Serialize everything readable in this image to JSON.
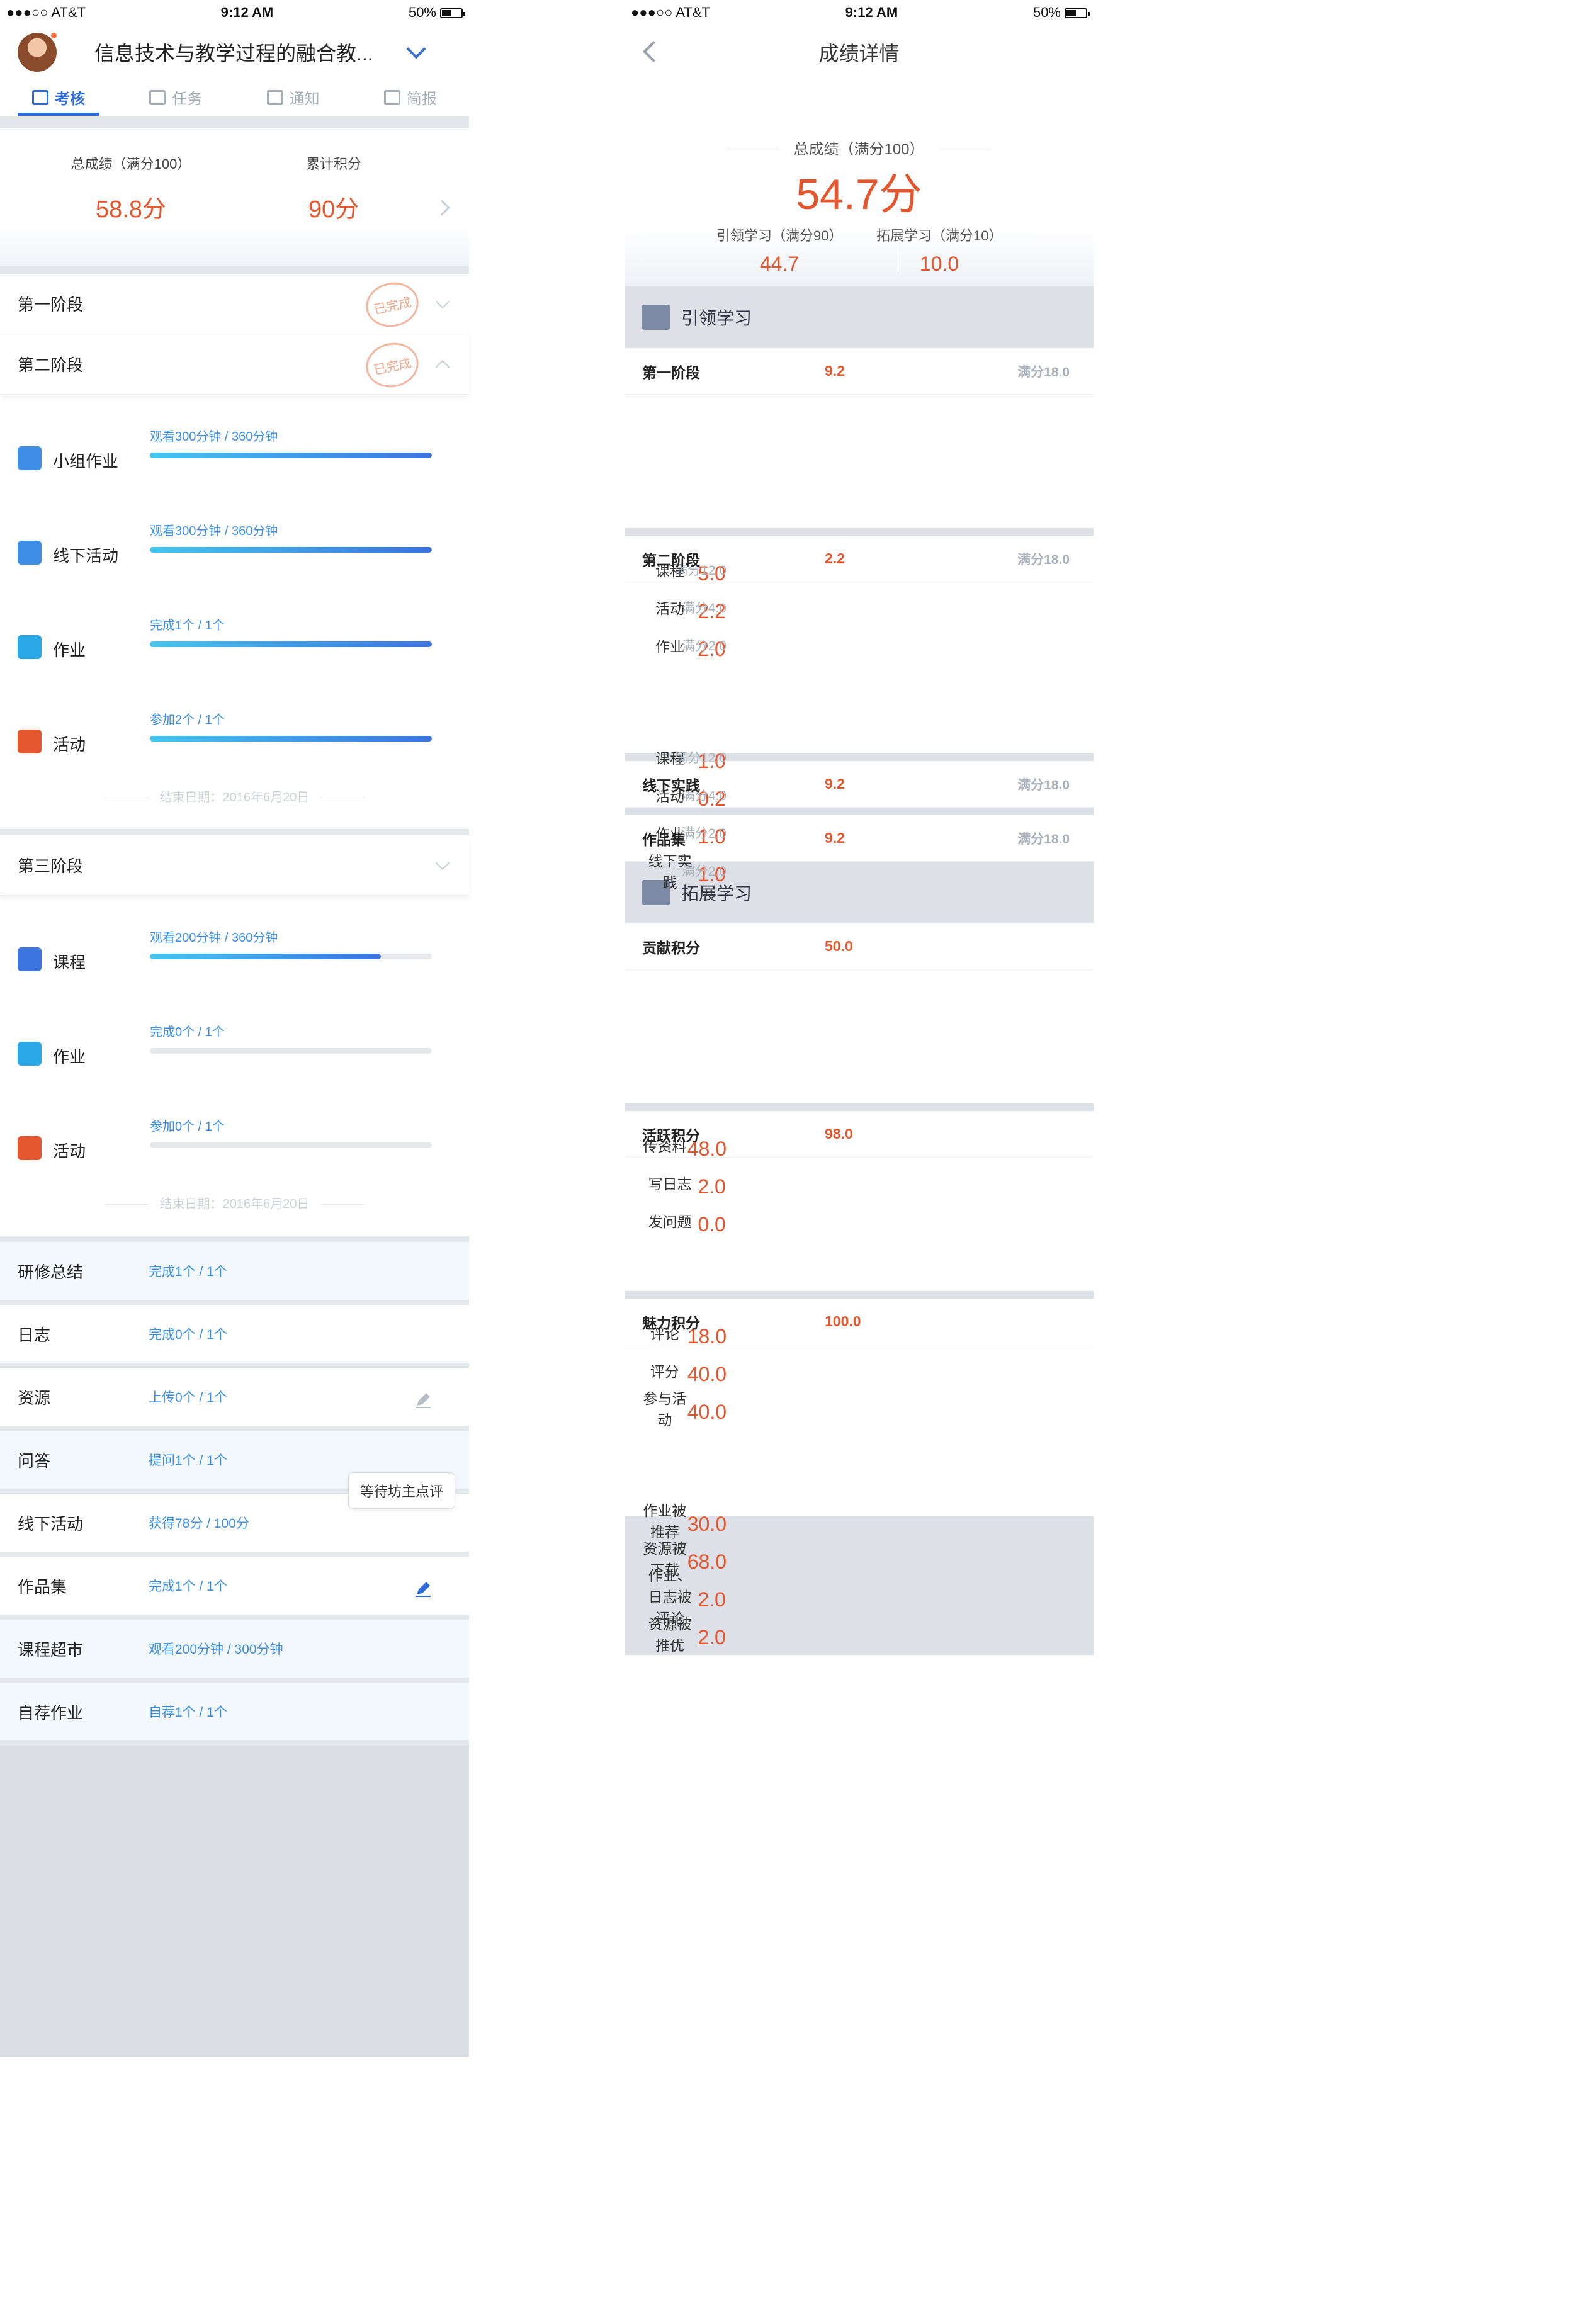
{
  "status": {
    "carrier": "●●●○○ AT&T",
    "time": "9:12 AM",
    "battery": "50%"
  },
  "left": {
    "title": "信息技术与教学过程的融合教...",
    "tabs": [
      {
        "label": "考核",
        "icon": "checklist-icon"
      },
      {
        "label": "任务",
        "icon": "task-icon"
      },
      {
        "label": "通知",
        "icon": "notice-icon"
      },
      {
        "label": "简报",
        "icon": "report-icon"
      }
    ],
    "summary": {
      "total_label": "总成绩（满分100）",
      "total_value": "58.8分",
      "points_label": "累计积分",
      "points_value": "90分"
    },
    "stages": [
      {
        "label": "第一阶段",
        "stamp": "已完成"
      },
      {
        "label": "第二阶段",
        "stamp": "已完成"
      },
      {
        "label": "第三阶段"
      }
    ],
    "stage2_tasks": [
      {
        "name": "小组作业",
        "progress": "观看300分钟 / 360分钟",
        "fill": 1.0,
        "icon": "group-work-icon"
      },
      {
        "name": "线下活动",
        "progress": "观看300分钟 / 360分钟",
        "fill": 1.0,
        "icon": "offline-activity-icon"
      },
      {
        "name": "作业",
        "progress": "完成1个 / 1个",
        "fill": 1.0,
        "icon": "homework-icon"
      },
      {
        "name": "活动",
        "progress": "参加2个 / 1个",
        "fill": 1.0,
        "icon": "paper-plane-icon"
      }
    ],
    "stage2_end": "结束日期：2016年6月20日",
    "stage3_tasks": [
      {
        "name": "课程",
        "progress": "观看200分钟 / 360分钟",
        "fill": 0.82,
        "icon": "course-book-icon"
      },
      {
        "name": "作业",
        "progress": "完成0个 / 1个",
        "fill": 0,
        "icon": "homework-icon"
      },
      {
        "name": "活动",
        "progress": "参加0个 / 1个",
        "fill": 0,
        "icon": "paper-plane-icon"
      }
    ],
    "stage3_end": "结束日期：2016年6月20日",
    "rows": [
      {
        "name": "研修总结",
        "progress": "完成1个 / 1个"
      },
      {
        "name": "日志",
        "progress": "完成0个 / 1个"
      },
      {
        "name": "资源",
        "progress": "上传0个 / 1个"
      },
      {
        "name": "问答",
        "progress": "提问1个 / 1个"
      },
      {
        "name": "线下活动",
        "progress": "获得78分 / 100分"
      },
      {
        "name": "作品集",
        "progress": "完成1个 / 1个"
      },
      {
        "name": "课程超市",
        "progress": "观看200分钟 / 300分钟"
      },
      {
        "name": "自荐作业",
        "progress": "自荐1个 / 1个"
      }
    ],
    "tooltip": "等待坊主点评"
  },
  "right": {
    "title": "成绩详情",
    "total_label": "总成绩（满分100）",
    "total_value": "54.7分",
    "lead_label": "引领学习（满分90）",
    "lead_value": "44.7",
    "ext_label": "拓展学习（满分10）",
    "ext_value": "10.0",
    "section1": "引领学习",
    "s1_groups": [
      {
        "name": "第一阶段",
        "value": "9.2",
        "max": "满分18.0",
        "items": [
          {
            "name": "课程",
            "value": "5.0",
            "max": "满分12.0"
          },
          {
            "name": "活动",
            "value": "2.2",
            "max": "满分4.0"
          },
          {
            "name": "作业",
            "value": "2.0",
            "max": "满分2.0"
          }
        ]
      },
      {
        "name": "第二阶段",
        "value": "2.2",
        "max": "满分18.0",
        "items": [
          {
            "name": "课程",
            "value": "1.0",
            "max": "满分12.0"
          },
          {
            "name": "活动",
            "value": "0.2",
            "max": "满分4.0"
          },
          {
            "name": "作业",
            "value": "1.0",
            "max": "满分2.0"
          },
          {
            "name": "线下实践",
            "value": "1.0",
            "max": "满分2.0"
          }
        ]
      },
      {
        "name": "线下实践",
        "value": "9.2",
        "max": "满分18.0",
        "items": []
      },
      {
        "name": "作品集",
        "value": "9.2",
        "max": "满分18.0",
        "items": []
      }
    ],
    "section2": "拓展学习",
    "s2_groups": [
      {
        "name": "贡献积分",
        "value": "50.0",
        "items": [
          {
            "name": "传资料",
            "value": "48.0"
          },
          {
            "name": "写日志",
            "value": "2.0"
          },
          {
            "name": "发问题",
            "value": "0.0"
          }
        ]
      },
      {
        "name": "活跃积分",
        "value": "98.0",
        "items": [
          {
            "name": "评论",
            "value": "18.0"
          },
          {
            "name": "评分",
            "value": "40.0"
          },
          {
            "name": "参与活动",
            "value": "40.0"
          }
        ]
      },
      {
        "name": "魅力积分",
        "value": "100.0",
        "items": [
          {
            "name": "作业被推荐",
            "value": "30.0"
          },
          {
            "name": "资源被下载",
            "value": "68.0"
          },
          {
            "name": "作业、日志被评论",
            "value": "2.0"
          },
          {
            "name": "资源被推优",
            "value": "2.0"
          }
        ]
      }
    ]
  }
}
